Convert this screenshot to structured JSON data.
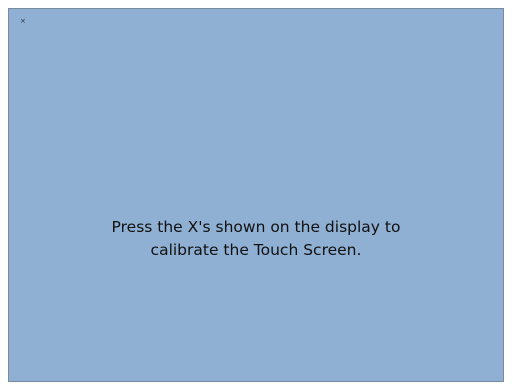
{
  "calibration": {
    "target_label": "×",
    "instructions": {
      "line1": "Press the X's shown on the display to",
      "line2": "calibrate the Touch Screen."
    }
  }
}
